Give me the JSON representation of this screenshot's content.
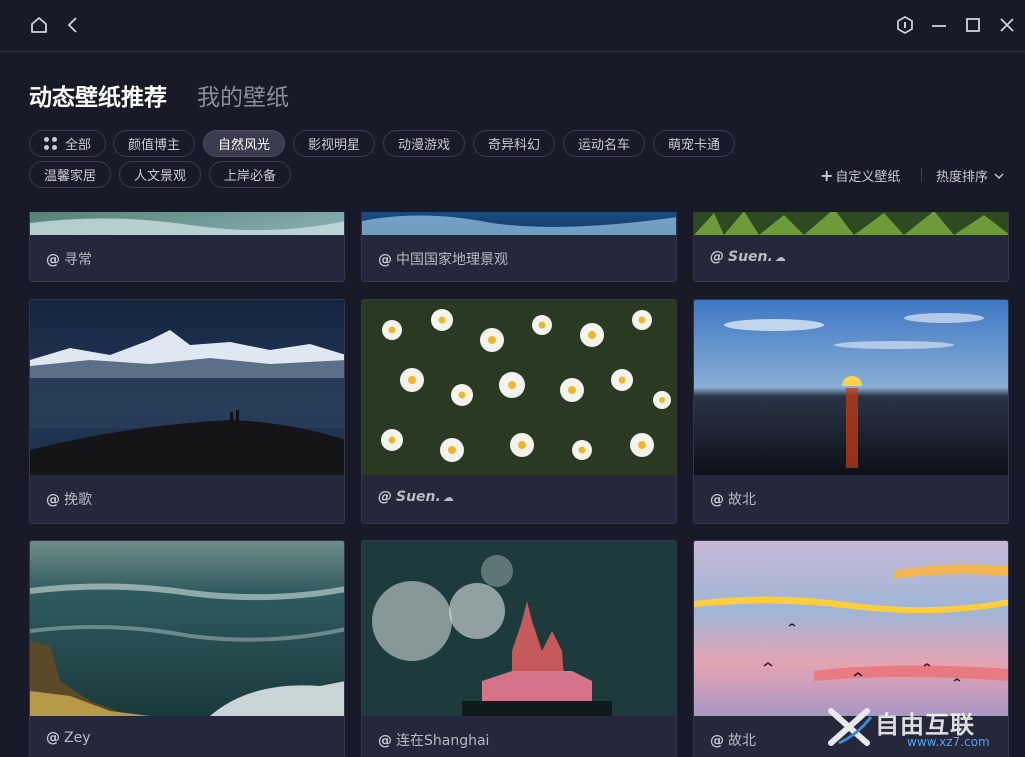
{
  "titlebar": {
    "home_icon": "home-icon",
    "back_icon": "chevron-left-icon",
    "shield_icon": "shield-icon",
    "minimize_icon": "minimize-icon",
    "maximize_icon": "maximize-icon",
    "close_icon": "close-icon"
  },
  "header": {
    "tabs": [
      {
        "label": "动态壁纸推荐",
        "active": true
      },
      {
        "label": "我的壁纸",
        "active": false
      }
    ]
  },
  "categories": [
    {
      "label": "全部",
      "icon": "grid-icon",
      "active": false
    },
    {
      "label": "颜值博主",
      "active": false
    },
    {
      "label": "自然风光",
      "active": true
    },
    {
      "label": "影视明星",
      "active": false
    },
    {
      "label": "动漫游戏",
      "active": false
    },
    {
      "label": "奇异科幻",
      "active": false
    },
    {
      "label": "运动名车",
      "active": false
    },
    {
      "label": "萌宠卡通",
      "active": false
    },
    {
      "label": "温馨家居",
      "active": false
    },
    {
      "label": "人文景观",
      "active": false
    },
    {
      "label": "上岸必备",
      "active": false
    }
  ],
  "actions": {
    "custom_label": "自定义壁纸",
    "sort_label": "热度排序"
  },
  "wallpapers": [
    {
      "author": "寻常",
      "scene": "waves-top"
    },
    {
      "author": "中国国家地理景观",
      "scene": "ocean-top"
    },
    {
      "author": "Suen.",
      "scene": "grass-top"
    },
    {
      "author": "挽歌",
      "scene": "mountain-night"
    },
    {
      "author": "Suen.",
      "scene": "daisies"
    },
    {
      "author": "故北",
      "scene": "sunset-sea"
    },
    {
      "author": "Zey",
      "scene": "sea-cliff"
    },
    {
      "author": "连在Shanghai",
      "scene": "castle-fireworks"
    },
    {
      "author": "故北",
      "scene": "pink-sky"
    }
  ],
  "watermark": {
    "text": "自由互联",
    "url": "www.xz7.com"
  }
}
